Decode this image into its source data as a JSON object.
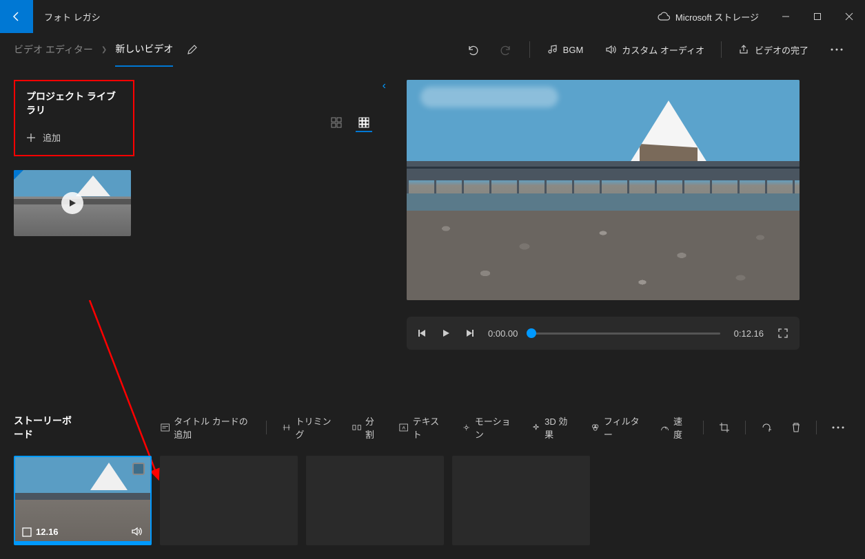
{
  "titlebar": {
    "app_title": "フォト レガシ",
    "storage_label": "Microsoft ストレージ"
  },
  "breadcrumb": {
    "editor": "ビデオ エディター",
    "current": "新しいビデオ"
  },
  "top_actions": {
    "bgm": "BGM",
    "custom_audio": "カスタム オーディオ",
    "finish": "ビデオの完了"
  },
  "library": {
    "title": "プロジェクト ライブラリ",
    "add": "追加"
  },
  "playback": {
    "current_time": "0:00.00",
    "total_time": "0:12.16"
  },
  "storyboard": {
    "title": "ストーリーボード",
    "tools": {
      "title_card": "タイトル カードの追加",
      "trimming": "トリミング",
      "split": "分割",
      "text": "テキスト",
      "motion": "モーション",
      "effect_3d": "3D 効果",
      "filter": "フィルター",
      "speed": "速度"
    },
    "clip_duration": "12.16"
  }
}
